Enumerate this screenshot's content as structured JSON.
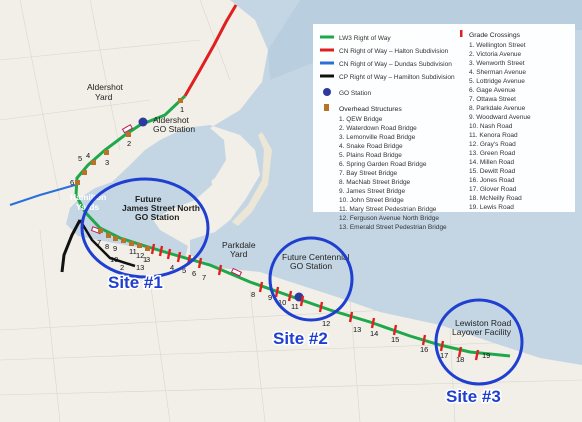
{
  "legend": {
    "lines": [
      {
        "label": "LW3 Right of Way",
        "color": "#1fa84a"
      },
      {
        "label": "CN Right of Way – Halton Subdivision",
        "color": "#e02020"
      },
      {
        "label": "CN Right of Way – Dundas Subdivision",
        "color": "#2a6fdc"
      },
      {
        "label": "CP Right of Way – Hamilton Subdivision",
        "color": "#111111"
      }
    ],
    "go_station_label": "GO Station",
    "go_station_color": "#2c3a9e",
    "overhead_title": "Overhead Structures",
    "overhead_color": "#b8732a",
    "overhead_items": [
      "1. QEW Bridge",
      "2. Waterdown Road Bridge",
      "3. Lemonville Road Bridge",
      "4. Snake Road Bridge",
      "5. Plains Road Bridge",
      "6. Spring Garden Road Bridge",
      "7. Bay Street Bridge",
      "8. MacNab Street Bridge",
      "9. James Street Bridge",
      "10. John Street Bridge",
      "11. Mary Street Pedestrian Bridge",
      "12. Ferguson Avenue North Bridge",
      "13. Emerald Street Pedestrian Bridge"
    ],
    "grade_title": "Grade Crossings",
    "grade_color": "#e02020",
    "grade_items": [
      "1. Wellington Street",
      "2. Victoria Avenue",
      "3. Wenworth Street",
      "4. Sherman Avenue",
      "5. Lottridge Avenue",
      "6. Gage Avenue",
      "7. Ottawa Street",
      "8. Parkdale Avenue",
      "9. Woodward Avenue",
      "10. Nash Road",
      "11. Kenora Road",
      "12. Gray's Road",
      "13. Green Road",
      "14. Millen Road",
      "15. Dewitt Road",
      "16. Jones Road",
      "17. Glover Road",
      "18. McNeilly Road",
      "19. Lewis Road"
    ]
  },
  "places": {
    "aldershot_yard": [
      "Aldershot",
      "Yard"
    ],
    "aldershot_go": [
      "Aldershot",
      "GO Station"
    ],
    "hamilton_yards": [
      "Hamilton",
      "Yards"
    ],
    "james_north_go": [
      "Future",
      "James Street North",
      "GO Station"
    ],
    "parkdale_yard": [
      "Parkdale",
      "Yard"
    ],
    "centennial_go": [
      "Future Centennial",
      "GO Station"
    ],
    "lewiston_layover": [
      "Lewiston Road",
      "Layover Facility"
    ]
  },
  "sites": [
    "Site #1",
    "Site #2",
    "Site #3"
  ],
  "map_numbers": {
    "overhead": [
      "1",
      "2",
      "3",
      "4",
      "5",
      "6",
      "7",
      "8",
      "9",
      "10",
      "11",
      "12",
      "13"
    ],
    "grade": [
      "1",
      "2",
      "3",
      "4",
      "5",
      "6",
      "7",
      "8",
      "9",
      "10",
      "11",
      "12",
      "13",
      "14",
      "15",
      "16",
      "17",
      "18",
      "19"
    ]
  }
}
